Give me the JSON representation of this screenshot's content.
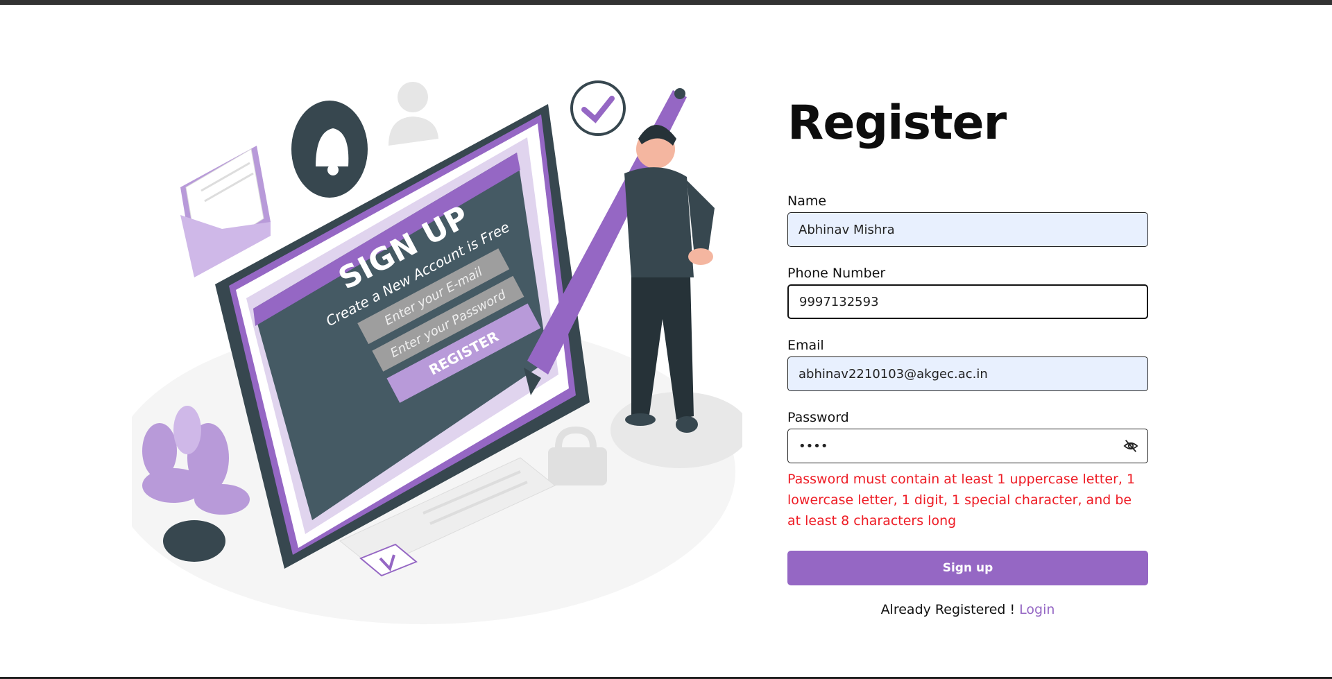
{
  "form": {
    "title": "Register",
    "name": {
      "label": "Name",
      "value": "Abhinav Mishra"
    },
    "phone": {
      "label": "Phone Number",
      "value": "9997132593"
    },
    "email": {
      "label": "Email",
      "value": "abhinav2210103@akgec.ac.in"
    },
    "password": {
      "label": "Password",
      "value": "••••",
      "toggle_icon": "eye-off-icon"
    },
    "error": "Password must contain at least 1 uppercase letter, 1 lowercase letter, 1 digit, 1 special character, and be at least 8 characters long",
    "submit_label": "Sign up",
    "login_prompt": "Already Registered !",
    "login_link": "Login"
  },
  "illustration": {
    "heading": "SIGN UP",
    "subheading": "Create a New Account is Free",
    "email_placeholder": "Enter your E-mail",
    "password_placeholder": "Enter your Password",
    "button_label": "REGISTER"
  },
  "colors": {
    "accent": "#9567c4",
    "error": "#ee1c25",
    "autofill": "#e8f0fe",
    "dark_slate": "#37474f"
  }
}
